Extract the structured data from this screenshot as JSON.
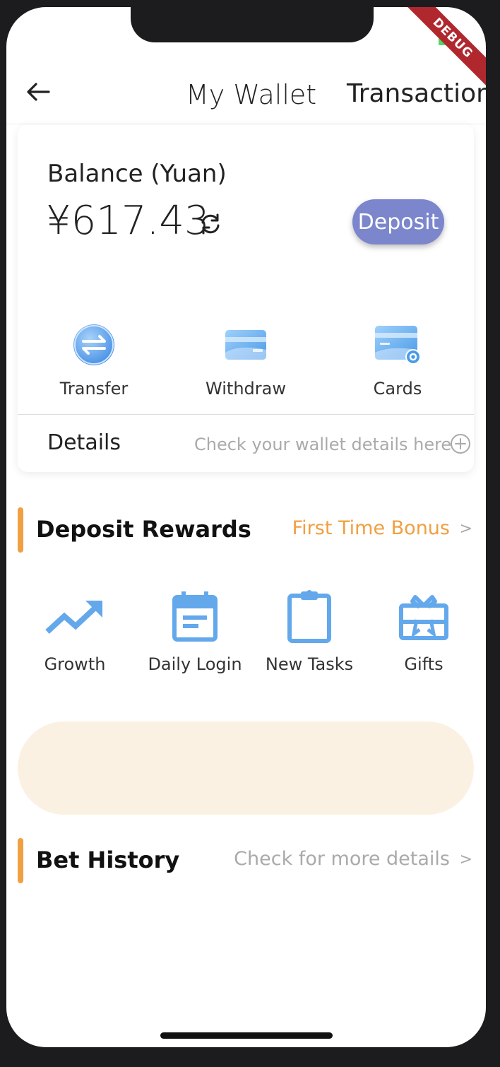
{
  "header": {
    "title": "My Wallet",
    "transactions_label": "Transactions"
  },
  "debug_badge": "DEBUG",
  "wallet": {
    "balance_label": "Balance (Yuan)",
    "balance_amount": "¥617.43",
    "deposit_label": "Deposit",
    "actions": [
      {
        "label": "Transfer",
        "icon": "transfer-icon"
      },
      {
        "label": "Withdraw",
        "icon": "card-icon"
      },
      {
        "label": "Cards",
        "icon": "card-settings-icon"
      }
    ],
    "details_label": "Details",
    "details_hint": "Check your wallet details here"
  },
  "deposit_rewards": {
    "title": "Deposit Rewards",
    "link": "First Time Bonus",
    "link_color": "#f0a040",
    "items": [
      {
        "label": "Growth",
        "icon": "trending-up-icon"
      },
      {
        "label": "Daily Login",
        "icon": "calendar-icon"
      },
      {
        "label": "New Tasks",
        "icon": "clipboard-icon"
      },
      {
        "label": "Gifts",
        "icon": "gift-icon"
      }
    ]
  },
  "bet_history": {
    "title": "Bet History",
    "link": "Check for more details"
  },
  "colors": {
    "accent_orange": "#f0a040",
    "deposit_button": "#7b86cc",
    "icon_blue": "#64a8ec",
    "banner": "#fbf1e3"
  }
}
